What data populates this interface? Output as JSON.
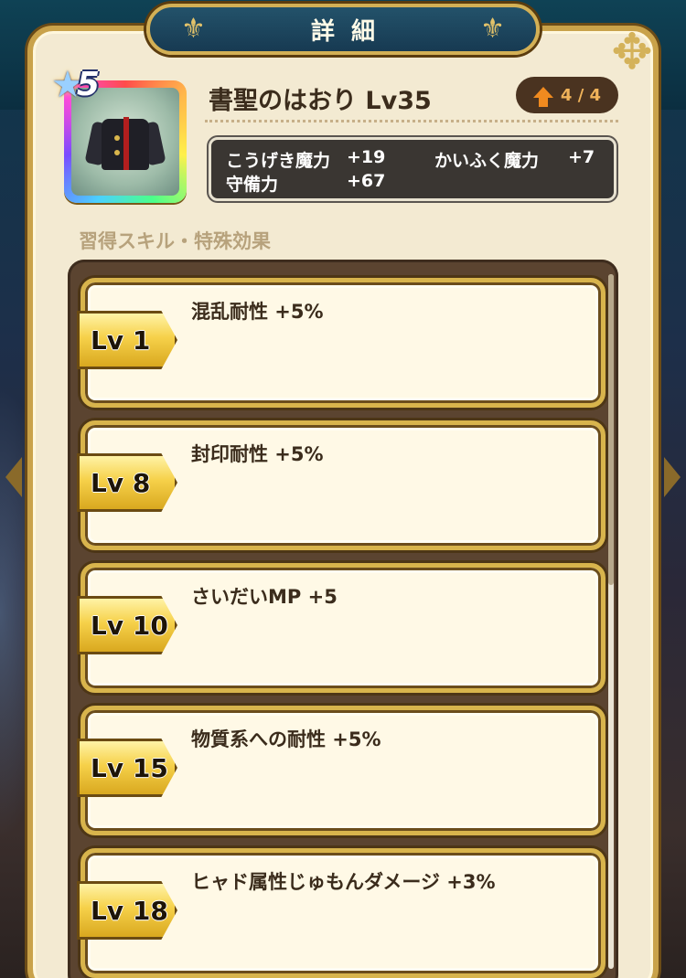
{
  "header": {
    "title": "詳細"
  },
  "item": {
    "name": "書聖のはおり Lv35",
    "rarity": "5",
    "upgrade_level": "4 / 4",
    "stats": [
      {
        "label": "こうげき魔力",
        "value": "+19"
      },
      {
        "label": "かいふく魔力",
        "value": "+7"
      },
      {
        "label": "守備力",
        "value": "+67"
      }
    ]
  },
  "skills_section": {
    "label": "習得スキル・特殊効果",
    "items": [
      {
        "level": "Lv 1",
        "effect": "混乱耐性 +5%"
      },
      {
        "level": "Lv 8",
        "effect": "封印耐性 +5%"
      },
      {
        "level": "Lv 10",
        "effect": "さいだいMP +5"
      },
      {
        "level": "Lv 15",
        "effect": "物質系への耐性 +5%"
      },
      {
        "level": "Lv 18",
        "effect": "ヒャド属性じゅもんダメージ +3%"
      }
    ]
  },
  "colors": {
    "panel": "#f3ead2",
    "gold": "#d8b44c",
    "banner": "#173a52",
    "text_dark": "#3b2c1c",
    "section_label": "#b7a27c"
  },
  "icons": {
    "rarity": "star-icon",
    "upgrade": "up-arrow-icon",
    "ornament": "fleur-de-lis-icon",
    "item": "jacket-icon"
  }
}
